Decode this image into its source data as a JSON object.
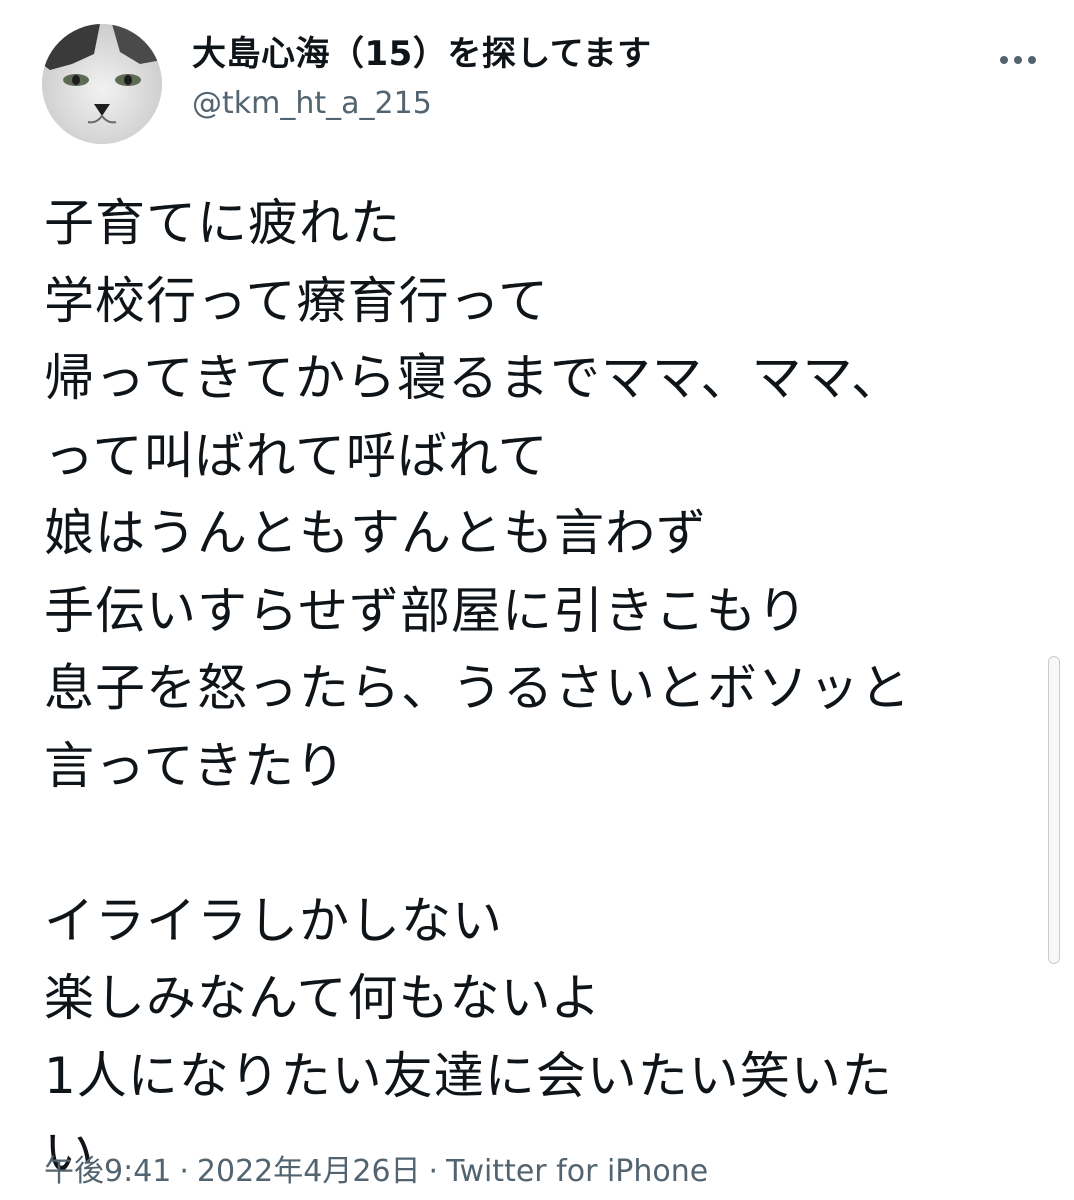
{
  "user": {
    "display_name": "大島心海（15）を探してます",
    "handle": "@tkm_ht_a_215",
    "avatar_icon": "cat-avatar-icon"
  },
  "tweet": {
    "lines": [
      "子育てに疲れた",
      "学校行って療育行って",
      "帰ってきてから寝るまでママ、ママ、",
      "って叫ばれて呼ばれて",
      "娘はうんともすんとも言わず",
      "手伝いすらせず部屋に引きこもり",
      "息子を怒ったら、うるさいとボソッと",
      "言ってきたり",
      "",
      "イライラしかしない",
      "楽しみなんて何もないよ",
      "1人になりたい友達に会いたい笑いた",
      "い"
    ]
  },
  "meta": {
    "time": "午後9:41",
    "separator": "·",
    "date": "2022年4月26日",
    "source": "Twitter for iPhone"
  },
  "colors": {
    "text": "#0f1419",
    "secondary": "#536471",
    "background": "#ffffff"
  },
  "icons": {
    "more": "more-dots-icon"
  }
}
